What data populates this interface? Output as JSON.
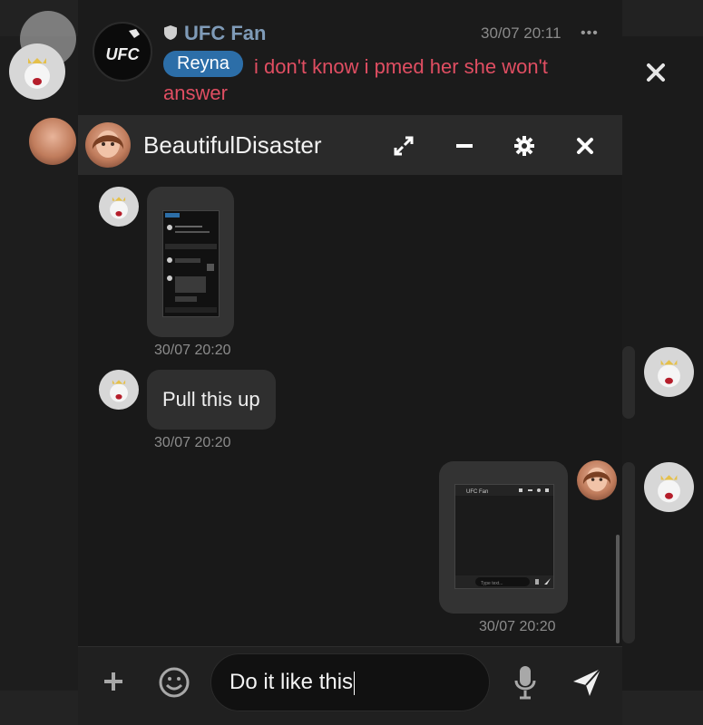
{
  "notification": {
    "sender": "UFC Fan",
    "sender_avatar_text": "UFC",
    "time": "30/07 20:11",
    "more": "•••",
    "mention": "Reyna",
    "text_line1": "i don't know i pmed her she won't",
    "text_line2": "answer"
  },
  "chat": {
    "title": "BeautifulDisaster",
    "messages": [
      {
        "type": "image",
        "time": "30/07 20:20",
        "side": "left"
      },
      {
        "type": "text",
        "text": "Pull this up",
        "time": "30/07 20:20",
        "side": "left"
      },
      {
        "type": "image",
        "time": "30/07 20:20",
        "side": "right"
      }
    ],
    "input_value": "Do it like this"
  },
  "thumb2": {
    "title": "UFC Fan",
    "placeholder": "Type text..."
  },
  "colors": {
    "accent_blue": "#2c6ea8",
    "mention_red": "#e04e62",
    "name_blue": "#7f9bb8"
  },
  "icons": {
    "expand": "expand-icon",
    "minimize": "minimize-icon",
    "settings": "gear-icon",
    "close": "close-icon",
    "add": "plus-icon",
    "emoji": "emoji-icon",
    "mic": "microphone-icon",
    "send": "send-icon"
  }
}
